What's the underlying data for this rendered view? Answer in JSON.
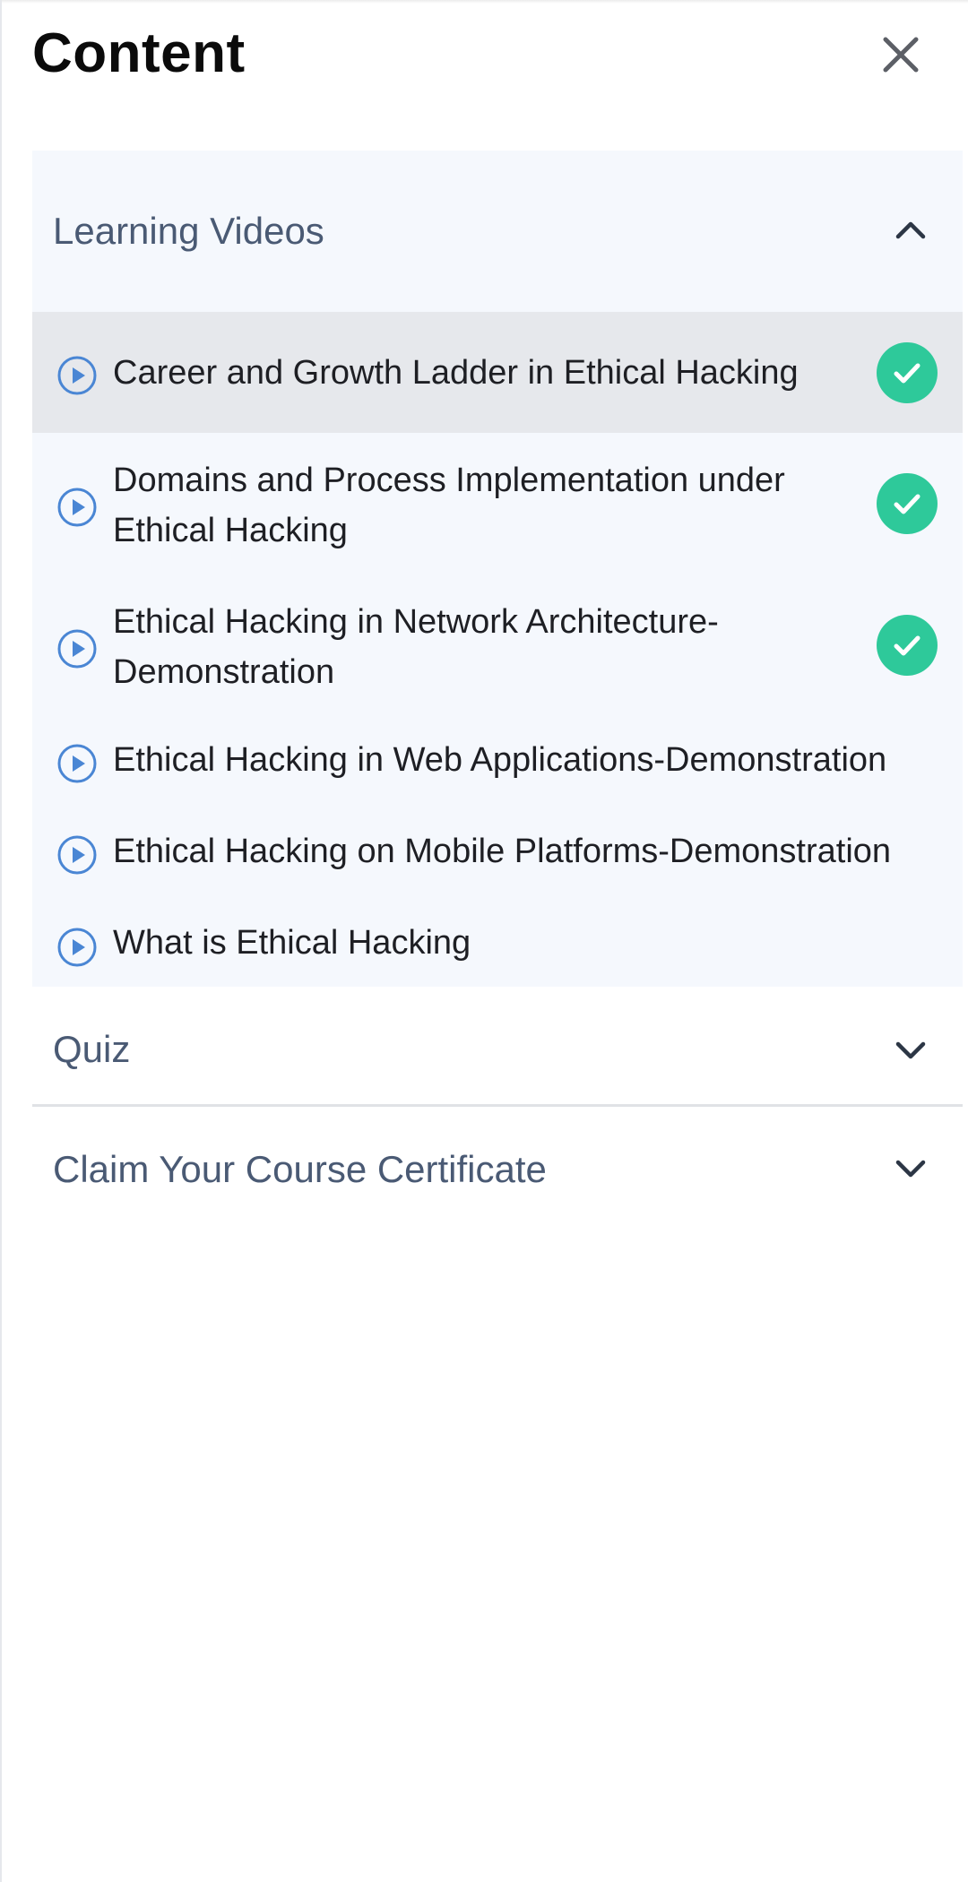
{
  "header": {
    "title": "Content",
    "close_icon": "close-icon"
  },
  "sections": [
    {
      "title": "Learning Videos",
      "expanded": true,
      "chevron_icon": "chevron-up-icon",
      "items": [
        {
          "label_lines": [
            "Career and Growth Ladder in Ethical Hacking"
          ],
          "completed": true,
          "active": true,
          "icon": "play-circle-icon"
        },
        {
          "label_lines": [
            "Domains and Process Implementation under",
            "Ethical Hacking"
          ],
          "completed": true,
          "active": false,
          "icon": "play-circle-icon"
        },
        {
          "label_lines": [
            "Ethical Hacking in Network Architecture-",
            "Demonstration"
          ],
          "completed": true,
          "active": false,
          "icon": "play-circle-icon"
        },
        {
          "label_lines": [
            "Ethical Hacking in Web Applications-Demonstration"
          ],
          "completed": false,
          "active": false,
          "icon": "play-circle-icon"
        },
        {
          "label_lines": [
            "Ethical Hacking on Mobile Platforms-Demonstration"
          ],
          "completed": false,
          "active": false,
          "icon": "play-circle-icon"
        },
        {
          "label_lines": [
            "What is Ethical Hacking"
          ],
          "completed": false,
          "active": false,
          "icon": "play-circle-icon"
        }
      ]
    },
    {
      "title": "Quiz",
      "expanded": false,
      "chevron_icon": "chevron-down-icon"
    },
    {
      "title": "Claim Your Course Certificate",
      "expanded": false,
      "chevron_icon": "chevron-down-icon"
    }
  ],
  "colors": {
    "accent_blue": "#4a86d4",
    "check_green": "#2ec99a",
    "section_text": "#4a5a74",
    "expanded_bg": "#f5f8fd",
    "active_row_bg": "#e6e8ec"
  }
}
